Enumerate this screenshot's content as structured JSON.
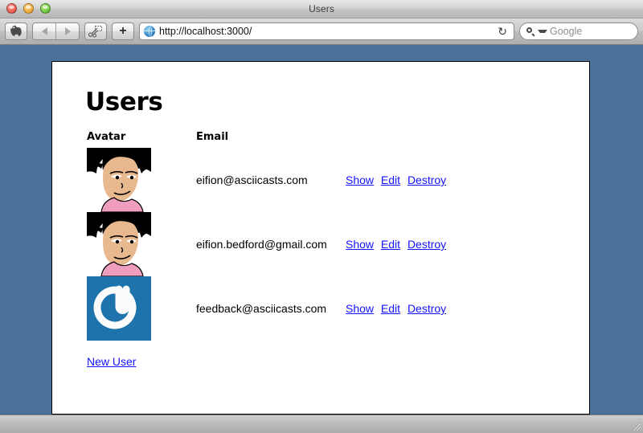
{
  "window": {
    "title": "Users",
    "controls": {
      "close": "close",
      "minimize": "minimize",
      "zoom": "zoom"
    }
  },
  "toolbar": {
    "evernote_label": "Evernote",
    "back_label": "Back",
    "forward_label": "Forward",
    "clip_label": "Clip",
    "add_tab_label": "+",
    "reload_label": "↻",
    "url": "http://localhost:3000/",
    "search_placeholder": "Google"
  },
  "page": {
    "title": "Users",
    "table": {
      "headers": [
        "Avatar",
        "Email"
      ],
      "rows": [
        {
          "avatar_type": "cartoon-avatar",
          "email": "eifion@asciicasts.com",
          "actions": [
            "Show",
            "Edit",
            "Destroy"
          ]
        },
        {
          "avatar_type": "cartoon-avatar",
          "email": "eifion.bedford@gmail.com",
          "actions": [
            "Show",
            "Edit",
            "Destroy"
          ]
        },
        {
          "avatar_type": "gravatar-logo",
          "email": "feedback@asciicasts.com",
          "actions": [
            "Show",
            "Edit",
            "Destroy"
          ]
        }
      ]
    },
    "new_user_link": "New User"
  },
  "colors": {
    "desktop_backdrop": "#4a7299",
    "link": "#1414ff",
    "gravatar_blue": "#1e73ac",
    "avatar_skin": "#e8b88f",
    "avatar_shirt": "#f09ec0",
    "avatar_hair": "#000000"
  }
}
